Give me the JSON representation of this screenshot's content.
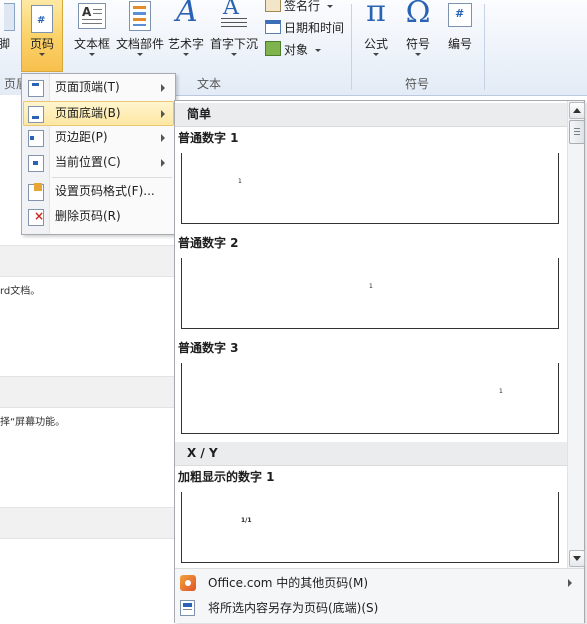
{
  "ribbon": {
    "buttons": {
      "left_edge": "脚",
      "page_number": "页码",
      "textbox": "文本框",
      "doc_parts": "文档部件",
      "wordart": "艺术字",
      "dropcap": "首字下沉",
      "equation": "公式",
      "symbol": "符号",
      "number": "编号"
    },
    "small_buttons": {
      "signature_line": "签名行",
      "date_time": "日期和时间",
      "object": "对象"
    },
    "groups": {
      "header_footer": "页眉",
      "text": "文本",
      "symbols": "符号"
    },
    "glyphs": {
      "pi": "π",
      "omega": "Ω",
      "hash": "#",
      "a_letter": "A"
    }
  },
  "document_snippets": {
    "line1": "rd文档。",
    "line2": "择“屏幕功能。"
  },
  "page_number_menu": {
    "items": [
      {
        "label": "页面顶端(T)",
        "icon": "page-top-icon",
        "submenu": true
      },
      {
        "label": "页面底端(B)",
        "icon": "page-bottom-icon",
        "submenu": true,
        "highlighted": true
      },
      {
        "label": "页边距(P)",
        "icon": "page-margin-icon",
        "submenu": true
      },
      {
        "label": "当前位置(C)",
        "icon": "current-position-icon",
        "submenu": true
      },
      {
        "label": "设置页码格式(F)...",
        "icon": "format-page-number-icon",
        "submenu": false
      },
      {
        "label": "删除页码(R)",
        "icon": "remove-page-number-icon",
        "submenu": false
      }
    ]
  },
  "gallery": {
    "category_simple": "简单",
    "category_xy": "X / Y",
    "items": [
      {
        "title": "普通数字 1",
        "sample": "1",
        "align": "left"
      },
      {
        "title": "普通数字 2",
        "sample": "1",
        "align": "center"
      },
      {
        "title": "普通数字 3",
        "sample": "1",
        "align": "right"
      },
      {
        "title": "加粗显示的数字 1",
        "sample": "1/1",
        "align": "left"
      }
    ],
    "footer": [
      {
        "label": "Office.com 中的其他页码(M)",
        "icon": "office-com-icon",
        "submenu": true
      },
      {
        "label": "将所选内容另存为页码(底端)(S)",
        "icon": "save-selection-icon",
        "submenu": false
      }
    ]
  },
  "colors": {
    "accent_highlight": "#fde7a2",
    "active_button": "#fbd36a",
    "icon_blue": "#2b63b4"
  }
}
